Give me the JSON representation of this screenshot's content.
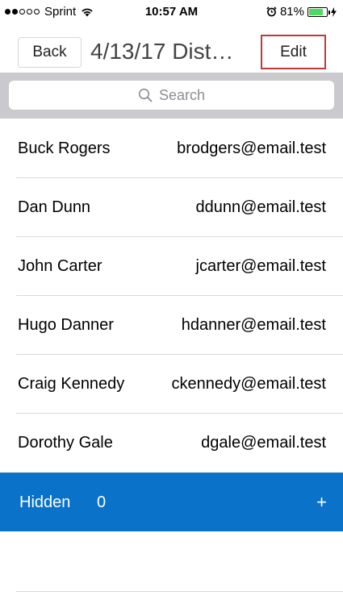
{
  "status": {
    "carrier": "Sprint",
    "signal_dots_filled": 2,
    "signal_dots_total": 5,
    "time": "10:57 AM",
    "battery": "81%",
    "battery_level": 0.81
  },
  "nav": {
    "back_label": "Back",
    "title": "4/13/17 Dist…",
    "edit_label": "Edit"
  },
  "search": {
    "placeholder": "Search"
  },
  "contacts": [
    {
      "name": "Buck Rogers",
      "email": "brodgers@email.test"
    },
    {
      "name": "Dan Dunn",
      "email": "ddunn@email.test"
    },
    {
      "name": "John Carter",
      "email": "jcarter@email.test"
    },
    {
      "name": "Hugo Danner",
      "email": "hdanner@email.test"
    },
    {
      "name": "Craig Kennedy",
      "email": "ckennedy@email.test"
    },
    {
      "name": "Dorothy Gale",
      "email": "dgale@email.test"
    }
  ],
  "hidden": {
    "label": "Hidden",
    "count": "0",
    "add": "+"
  },
  "colors": {
    "accent": "#0a72c9",
    "highlight_border": "#c0393b",
    "battery": "#4cd964"
  }
}
